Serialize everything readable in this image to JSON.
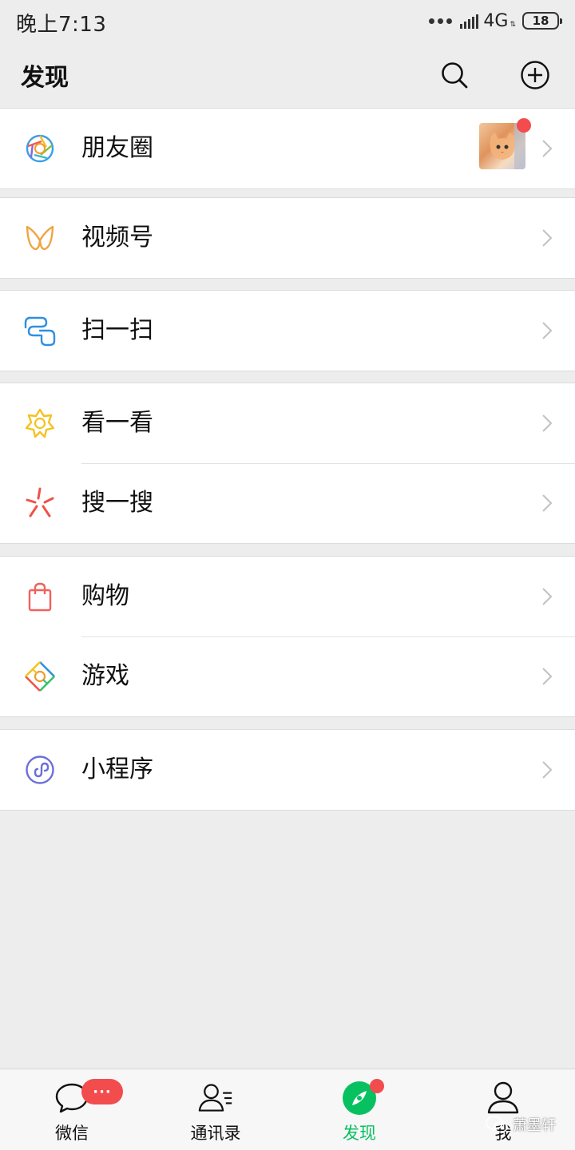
{
  "status_bar": {
    "time": "晚上7:13",
    "network": "4G",
    "battery": "18"
  },
  "header": {
    "title": "发现",
    "search_icon": "search-icon",
    "add_icon": "add-circle-icon"
  },
  "groups": [
    {
      "items": [
        {
          "label": "朋友圈",
          "icon": "moments-aperture-icon",
          "has_thumbnail": true,
          "has_new_dot": true
        }
      ]
    },
    {
      "items": [
        {
          "label": "视频号",
          "icon": "channels-butterfly-icon"
        }
      ]
    },
    {
      "items": [
        {
          "label": "扫一扫",
          "icon": "scan-icon"
        }
      ]
    },
    {
      "items": [
        {
          "label": "看一看",
          "icon": "top-stories-icon"
        },
        {
          "label": "搜一搜",
          "icon": "search-sparkle-icon"
        }
      ]
    },
    {
      "items": [
        {
          "label": "购物",
          "icon": "shopping-bag-icon"
        },
        {
          "label": "游戏",
          "icon": "games-diamond-icon"
        }
      ]
    },
    {
      "items": [
        {
          "label": "小程序",
          "icon": "mini-program-icon"
        }
      ]
    }
  ],
  "tabs": [
    {
      "label": "微信",
      "icon": "chat-bubble-icon",
      "badge": "···",
      "active": false
    },
    {
      "label": "通讯录",
      "icon": "contacts-icon",
      "active": false
    },
    {
      "label": "发现",
      "icon": "compass-icon",
      "has_dot": true,
      "active": true
    },
    {
      "label": "我",
      "icon": "profile-icon",
      "active": false
    }
  ],
  "watermark": "萧墨轩",
  "colors": {
    "accent_green": "#07c160",
    "badge_red": "#f24c4c",
    "background": "#ededed"
  }
}
